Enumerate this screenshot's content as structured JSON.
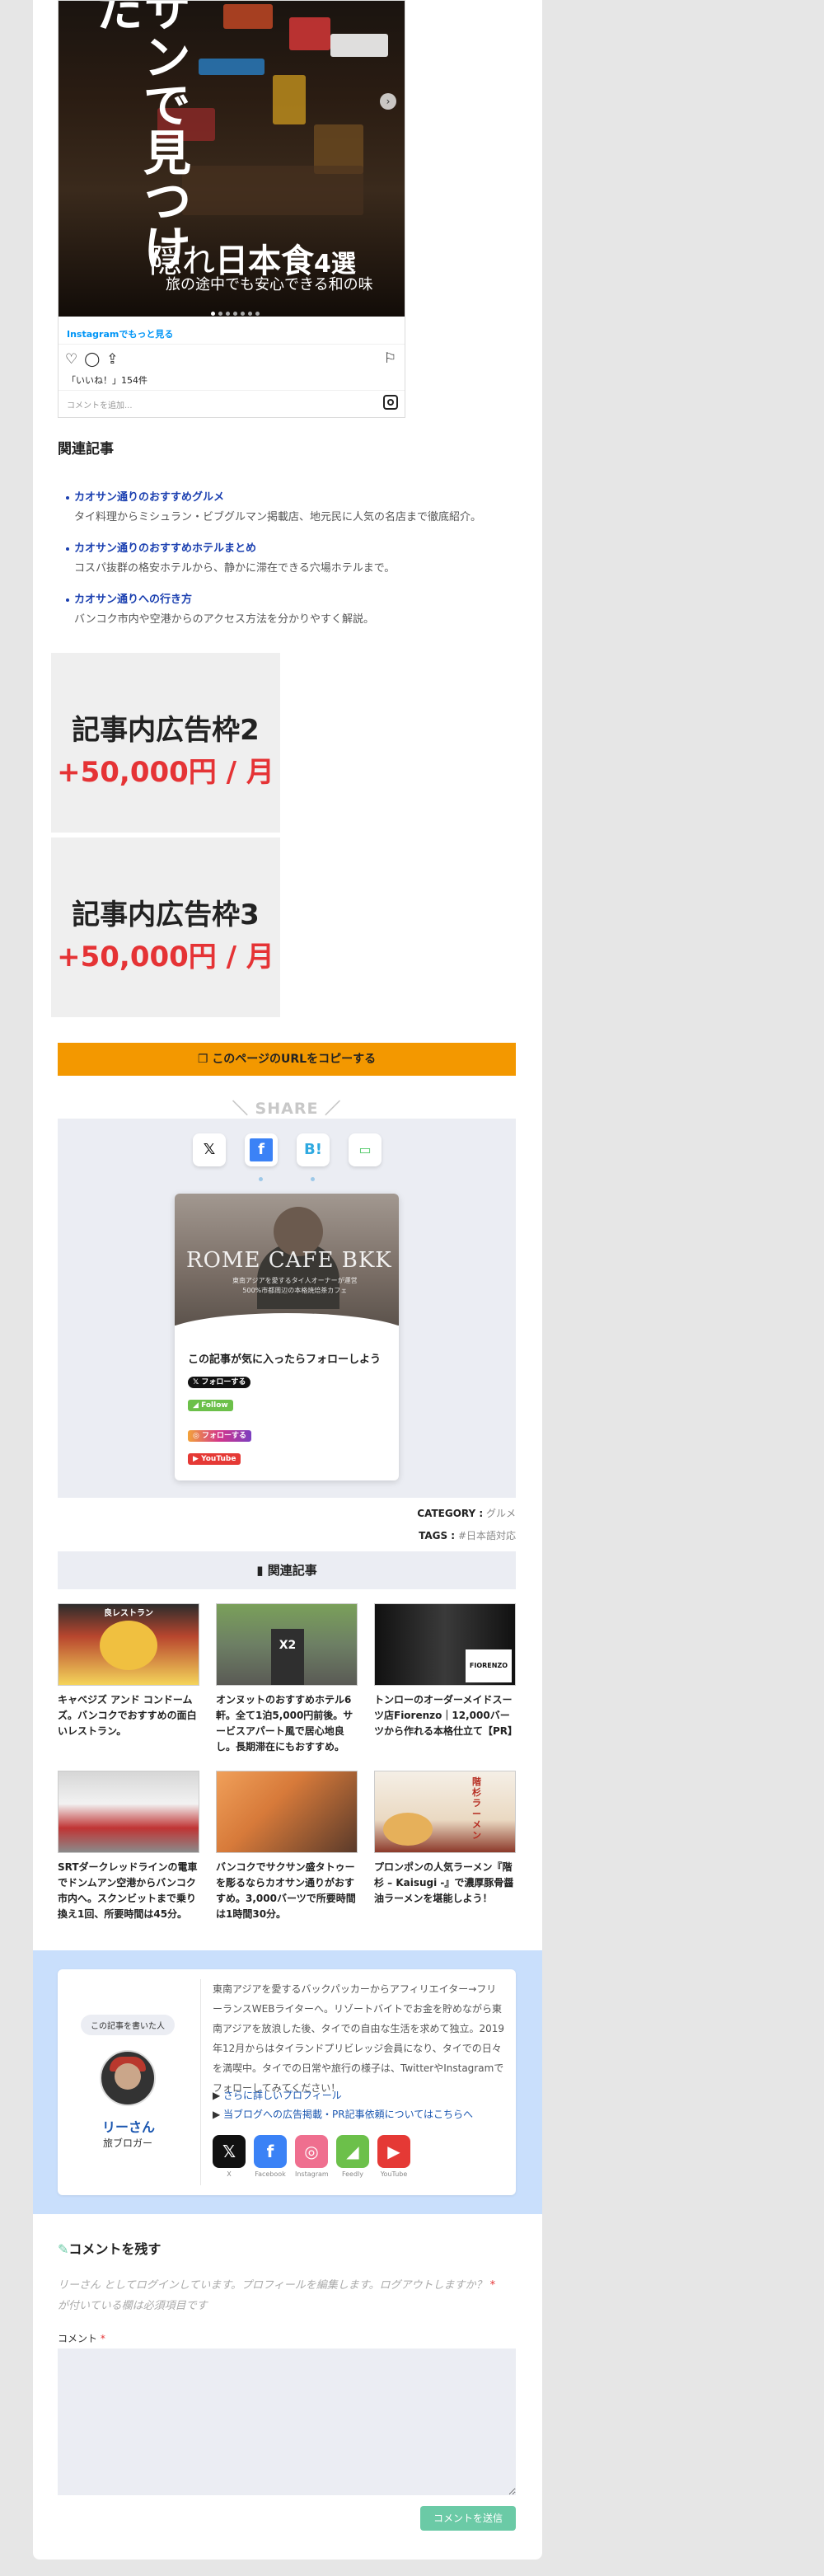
{
  "instagram": {
    "vertical_title": "サンで見つけた",
    "caption_light": "隠れ",
    "caption_bold": "日本食",
    "caption_num": "4選",
    "subcaption": "旅の途中でも安心できる和の味",
    "more_link": "Instagramでもっと見る",
    "likes": "「いいね！」154件",
    "comment_placeholder": "コメントを追加..."
  },
  "related_section": {
    "title": "関連記事",
    "items": [
      {
        "link": "カオサン通りのおすすめグルメ",
        "desc": "タイ料理からミシュラン・ビブグルマン掲載店、地元民に人気の名店まで徹底紹介。"
      },
      {
        "link": "カオサン通りのおすすめホテルまとめ",
        "desc": "コスパ抜群の格安ホテルから、静かに滞在できる穴場ホテルまで。"
      },
      {
        "link": "カオサン通りへの行き方",
        "desc": "バンコク市内や空港からのアクセス方法を分かりやすく解説。"
      }
    ]
  },
  "ads": [
    {
      "title": "記事内広告枠2",
      "price": "+50,000円 / 月"
    },
    {
      "title": "記事内広告枠3",
      "price": "+50,000円 / 月"
    }
  ],
  "copy_button": "このページのURLをコピーする",
  "share": {
    "heading": "SHARE",
    "buttons": [
      {
        "icon": "x-icon",
        "glyph": "𝕏"
      },
      {
        "icon": "facebook-icon",
        "glyph": "f"
      },
      {
        "icon": "hatena-icon",
        "glyph": "B!"
      },
      {
        "icon": "line-icon",
        "glyph": "▭"
      }
    ]
  },
  "follow_box": {
    "shop_name": "ROME CAFE BKK",
    "shop_sub": "東南アジアを愛するタイ人オーナーが運営\n500%市都周辺の本格焼焙茶カフェ",
    "title": "この記事が気に入ったらフォローしよう",
    "x_follow": "フォローする",
    "feedly": "Follow",
    "instagram": "フォローする",
    "youtube": "YouTube"
  },
  "meta": {
    "category_label": "CATEGORY :",
    "category_value": "グルメ",
    "tags_label": "TAGS :",
    "tags_value": "#日本語対応"
  },
  "related_grid": {
    "title": "関連記事",
    "cards": [
      {
        "title": "キャベジズ アンド コンドームズ。バンコクでおすすめの面白いレストラン。",
        "thumb_text": "良レストラン"
      },
      {
        "title": "オンヌットのおすすめホテル6軒。全て1泊5,000円前後。サービスアパート風で居心地良し。長期滞在にもおすすめ。",
        "thumb_text": "X2"
      },
      {
        "title": "トンローのオーダーメイドスーツ店Fiorenzo｜12,000バーツから作れる本格仕立て【PR】",
        "thumb_text": "FIORENZO"
      },
      {
        "title": "SRTダークレッドラインの電車でドンムアン空港からバンコク市内へ。スクンビットまで乗り換え1回、所要時間は45分。",
        "thumb_text": ""
      },
      {
        "title": "バンコクでサクサン盛タトゥーを彫るならカオサン通りがおすすめ。3,000バーツで所要時間は1時間30分。",
        "thumb_text": ""
      },
      {
        "title": "プロンポンの人気ラーメン『階杉 – Kaisugi -』で濃厚豚骨醤油ラーメンを堪能しよう！",
        "thumb_text": "階杉ラーメン"
      }
    ]
  },
  "author": {
    "tag": "この記事を書いた人",
    "name": "リーさん",
    "role": "旅ブロガー",
    "bio": "東南アジアを愛するバックパッカーからアフィリエイター→フリーランスWEBライターへ。リゾートバイトでお金を貯めながら東南アジアを放浪した後、タイでの自由な生活を求めて独立。2019年12月からはタイランドプリビレッジ会員になり、タイでの日々を満喫中。タイでの日常や旅行の様子は、TwitterやInstagramでフォローしてみてください！",
    "profile_link": "さらに詳しいプロフィール",
    "ad_link": "当ブログへの広告掲載・PR記事依頼についてはこちらへ",
    "socials": [
      {
        "label": "X",
        "glyph": "𝕏",
        "color": "#111111"
      },
      {
        "label": "Facebook",
        "glyph": "f",
        "color": "#3b82f6"
      },
      {
        "label": "Instagram",
        "glyph": "◎",
        "color": "#ef6f8f"
      },
      {
        "label": "Feedly",
        "glyph": "◢",
        "color": "#6cc04a"
      },
      {
        "label": "YouTube",
        "glyph": "▶",
        "color": "#e53935"
      }
    ]
  },
  "comment": {
    "title": "コメントを残す",
    "logged_in": "リーさん としてログインしています。プロフィールを編集します。ログアウトしますか？",
    "required_note": "が付いている欄は必須項目です",
    "label": "コメント",
    "submit": "コメントを送信"
  },
  "colors": {
    "accent_orange": "#f39800",
    "link_blue": "#1a3fb0",
    "price_red": "#e53335",
    "author_band": "#c9dffc",
    "submit_green": "#6bcaa6"
  }
}
